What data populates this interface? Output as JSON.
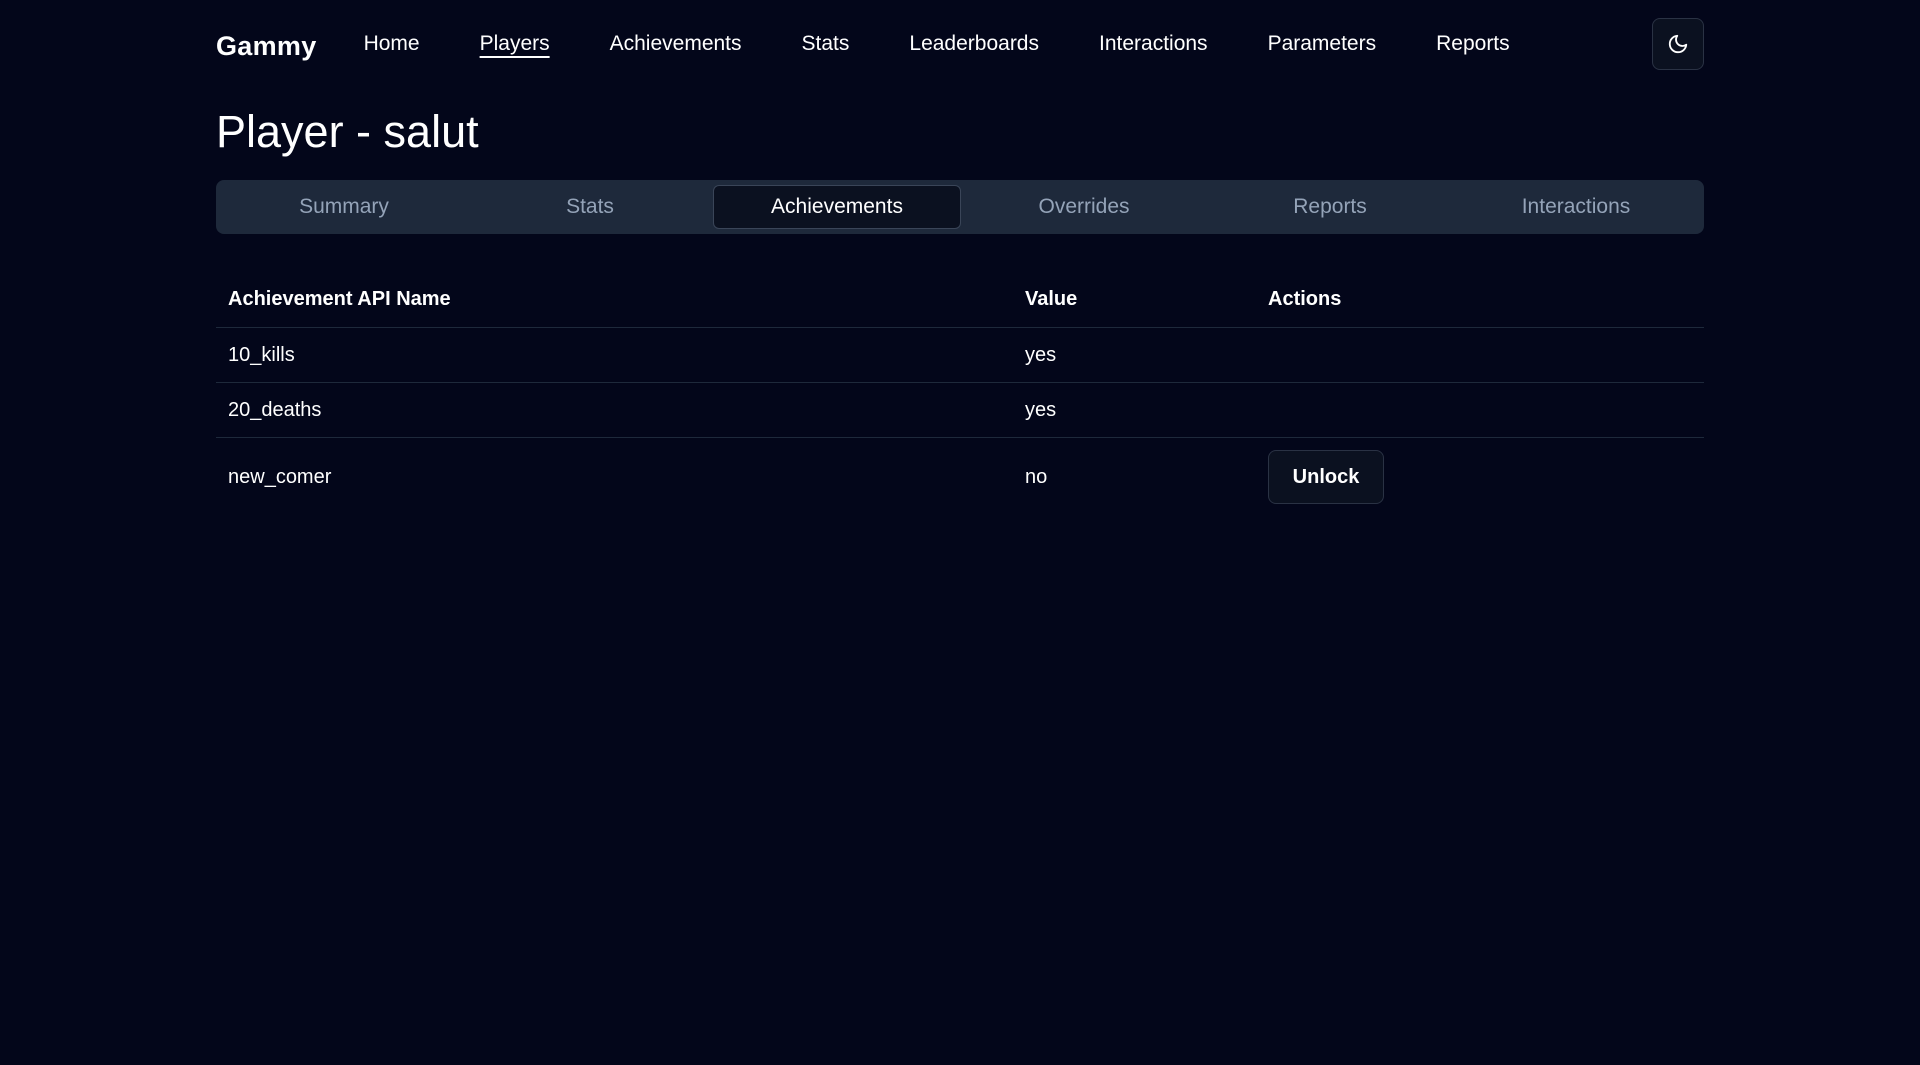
{
  "nav": {
    "brand": "Gammy",
    "links": [
      "Home",
      "Players",
      "Achievements",
      "Stats",
      "Leaderboards",
      "Interactions",
      "Parameters",
      "Reports"
    ],
    "active": "Players",
    "theme_toggle_icon": "moon-icon"
  },
  "page": {
    "title": "Player - salut"
  },
  "tabs": {
    "items": [
      "Summary",
      "Stats",
      "Achievements",
      "Overrides",
      "Reports",
      "Interactions"
    ],
    "active": "Achievements"
  },
  "table": {
    "headers": [
      "Achievement API Name",
      "Value",
      "Actions"
    ],
    "rows": [
      {
        "name": "10_kills",
        "value": "yes",
        "action": ""
      },
      {
        "name": "20_deaths",
        "value": "yes",
        "action": ""
      },
      {
        "name": "new_comer",
        "value": "no",
        "action": "Unlock"
      }
    ]
  },
  "colors": {
    "background": "#03061a",
    "tabs_background": "#1e293b",
    "muted_text": "#94a3b8"
  }
}
